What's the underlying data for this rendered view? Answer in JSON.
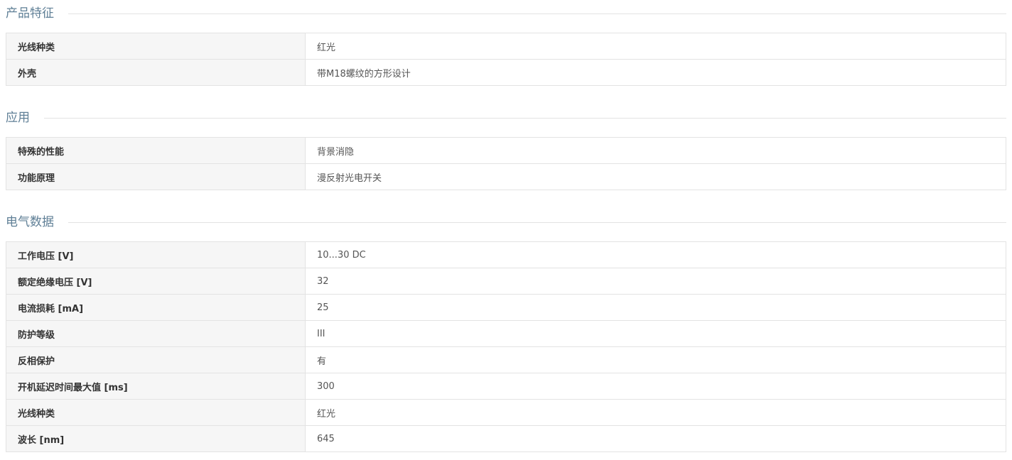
{
  "sections": [
    {
      "title": "产品特征",
      "rows": [
        {
          "label": "光线种类",
          "value": "红光"
        },
        {
          "label": "外壳",
          "value": "带M18螺纹的方形设计"
        }
      ]
    },
    {
      "title": "应用",
      "rows": [
        {
          "label": "特殊的性能",
          "value": "背景消隐"
        },
        {
          "label": "功能原理",
          "value": "漫反射光电开关"
        }
      ]
    },
    {
      "title": "电气数据",
      "rows": [
        {
          "label": "工作电压 [V]",
          "value": "10...30 DC"
        },
        {
          "label": "额定绝缘电压 [V]",
          "value": "32"
        },
        {
          "label": "电流损耗 [mA]",
          "value": "25"
        },
        {
          "label": "防护等级",
          "value": "III"
        },
        {
          "label": "反相保护",
          "value": "有"
        },
        {
          "label": "开机延迟时间最大值 [ms]",
          "value": "300"
        },
        {
          "label": "光线种类",
          "value": "红光"
        },
        {
          "label": "波长 [nm]",
          "value": "645"
        }
      ]
    }
  ],
  "colors": {
    "section_title": "#5f7f96",
    "border": "#e3e3e3",
    "label_bg": "#f6f6f6"
  }
}
